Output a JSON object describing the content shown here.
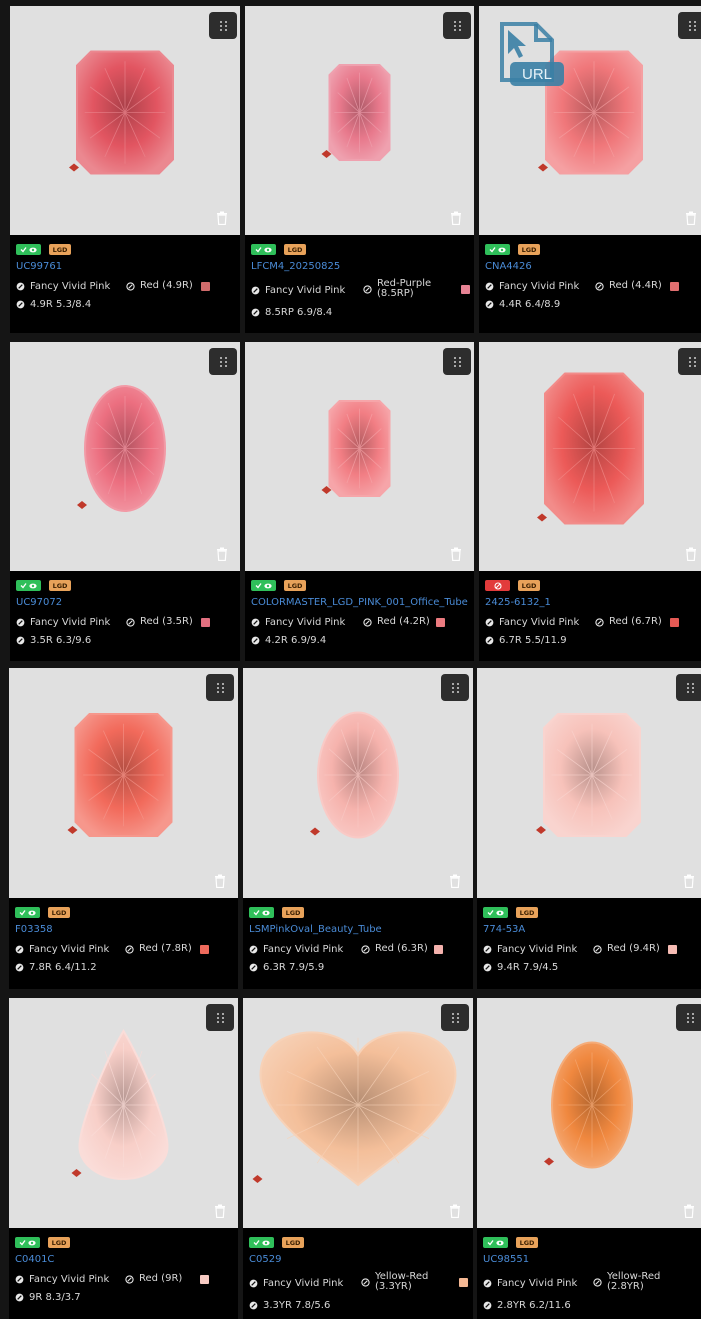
{
  "cards": [
    {
      "id": "UC99761",
      "status": "ok",
      "badge": "LGD",
      "color_grade": "Fancy Vivid Pink",
      "hue": "Red (4.9R)",
      "swatch": "#d06b6b",
      "spec": "4.9R 5.3/8.4",
      "gem_color": "#e25561",
      "shape": "radiant"
    },
    {
      "id": "LFCM4_20250825",
      "status": "ok",
      "badge": "LGD",
      "color_grade": "Fancy Vivid Pink",
      "hue": "Red-Purple (8.5RP)",
      "swatch": "#e78394",
      "spec": "8.5RP 6.9/8.4",
      "gem_color": "#e8798c",
      "shape": "emerald"
    },
    {
      "id": "CNA4426",
      "status": "ok",
      "badge": "LGD",
      "color_grade": "Fancy Vivid Pink",
      "hue": "Red (4.4R)",
      "swatch": "#e06f70",
      "spec": "4.4R 6.4/8.9",
      "gem_color": "#f0777a",
      "shape": "radiant"
    },
    {
      "id": "UC97072",
      "status": "ok",
      "badge": "LGD",
      "color_grade": "Fancy Vivid Pink",
      "hue": "Red (3.5R)",
      "swatch": "#e27080",
      "spec": "3.5R 6.3/9.6",
      "gem_color": "#ec6f80",
      "shape": "oval"
    },
    {
      "id": "COLORMASTER_LGD_PINK_001_Office_Tube",
      "status": "ok",
      "badge": "LGD",
      "color_grade": "Fancy Vivid Pink",
      "hue": "Red (4.2R)",
      "swatch": "#ec7b80",
      "spec": "4.2R 6.9/9.4",
      "gem_color": "#f27e84",
      "shape": "emerald"
    },
    {
      "id": "2425-6132_1",
      "status": "bad",
      "badge": "LGD",
      "color_grade": "Fancy Vivid Pink",
      "hue": "Red (6.7R)",
      "swatch": "#e55a55",
      "spec": "6.7R 5.5/11.9",
      "gem_color": "#ec5a58",
      "shape": "cushion"
    },
    {
      "id": "F03358",
      "status": "ok",
      "badge": "LGD",
      "color_grade": "Fancy Vivid Pink",
      "hue": "Red (7.8R)",
      "swatch": "#ee6a5c",
      "spec": "7.8R 6.4/11.2",
      "gem_color": "#f26a5b",
      "shape": "radiant"
    },
    {
      "id": "LSMPinkOval_Beauty_Tube",
      "status": "ok",
      "badge": "LGD",
      "color_grade": "Fancy Vivid Pink",
      "hue": "Red (6.3R)",
      "swatch": "#f4b2ad",
      "spec": "6.3R 7.9/5.9",
      "gem_color": "#f6b3ad",
      "shape": "oval"
    },
    {
      "id": "774-53A",
      "status": "ok",
      "badge": "LGD",
      "color_grade": "Fancy Vivid Pink",
      "hue": "Red (9.4R)",
      "swatch": "#f6bcb4",
      "spec": "9.4R 7.9/4.5",
      "gem_color": "#f7c2ba",
      "shape": "radiant"
    },
    {
      "id": "C0401C",
      "status": "ok",
      "badge": "LGD",
      "color_grade": "Fancy Vivid Pink",
      "hue": "Red (9R)",
      "swatch": "#f7cac3",
      "spec": "9R 8.3/3.7",
      "gem_color": "#f8cfc8",
      "shape": "pear"
    },
    {
      "id": "C0529",
      "status": "ok",
      "badge": "LGD",
      "color_grade": "Fancy Vivid Pink",
      "hue": "Yellow-Red (3.3YR)",
      "swatch": "#f5b894",
      "spec": "3.3YR 7.8/5.6",
      "gem_color": "#f4bf9a",
      "shape": "heart"
    },
    {
      "id": "UC98551",
      "status": "ok",
      "badge": "LGD",
      "color_grade": "Fancy Vivid Pink",
      "hue": "Yellow-Red (2.8YR)",
      "swatch": "#f08a3c",
      "spec": "2.8YR 6.2/11.6",
      "gem_color": "#f0883f",
      "shape": "oval"
    }
  ],
  "overlay": {
    "label": "URL"
  },
  "icons": {
    "drag": "drag-handle-icon",
    "trash": "trash-icon",
    "color": "color-grade-icon",
    "hue": "hue-icon",
    "spec": "spec-icon"
  }
}
